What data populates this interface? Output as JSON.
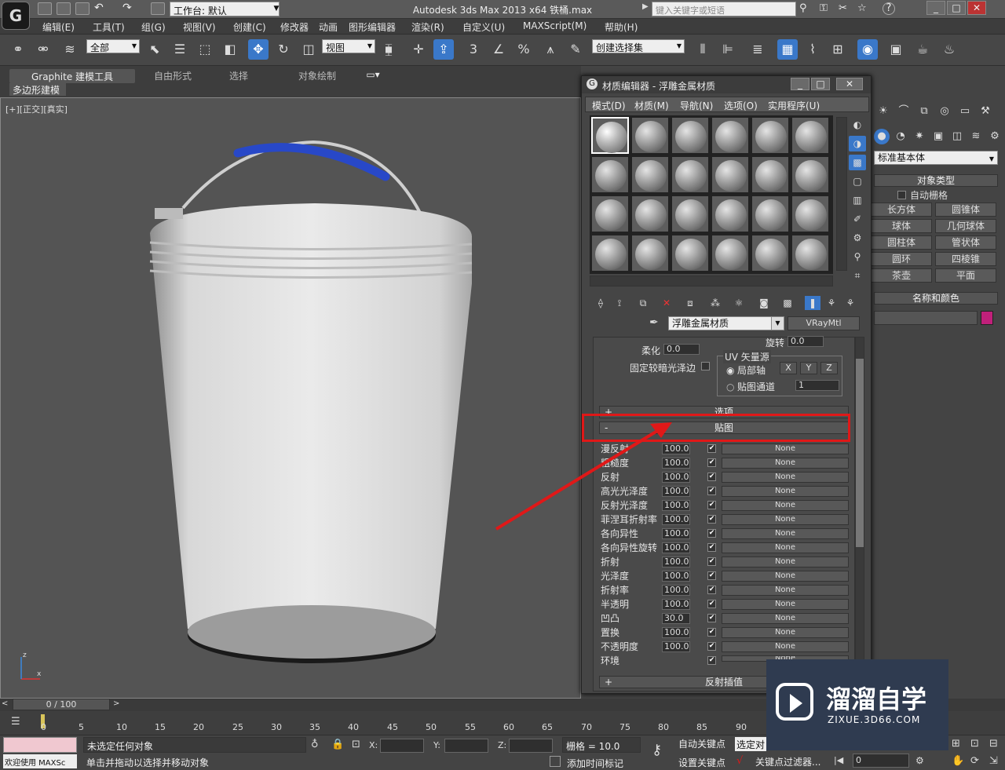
{
  "titlebar": {
    "workspace": "工作台: 默认",
    "title": "Autodesk 3ds Max  2013 x64     铁桶.max",
    "search_placeholder": "键入关键字或短语"
  },
  "menubar": [
    "编辑(E)",
    "工具(T)",
    "组(G)",
    "视图(V)",
    "创建(C)",
    "修改器",
    "动画",
    "图形编辑器",
    "渲染(R)",
    "自定义(U)",
    "MAXScript(M)",
    "帮助(H)"
  ],
  "toolbar": {
    "filter": "全部",
    "coord": "视图",
    "sel_set": "创建选择集",
    "snap_3": "3"
  },
  "ribbon": {
    "tabs": [
      "Graphite 建模工具",
      "自由形式",
      "选择",
      "对象绘制"
    ],
    "sub_tab": "多边形建模"
  },
  "viewport": {
    "label": "[+][正交][真实]"
  },
  "material_editor": {
    "title": "材质编辑器 - 浮雕金属材质",
    "menu": [
      "模式(D)",
      "材质(M)",
      "导航(N)",
      "选项(O)",
      "实用程序(U)"
    ],
    "material_name": "浮雕金属材质",
    "material_type": "VRayMtl",
    "soften_label": "柔化",
    "soften_val": "0.0",
    "fix_gloss_label": "固定较暗光泽边",
    "rotate_label": "旋转",
    "rotate_val": "0.0",
    "uv_group": "UV 矢量源",
    "local_axis": "局部轴",
    "map_channel": "贴图通道",
    "map_channel_val": "1",
    "axes": [
      "X",
      "Y",
      "Z"
    ],
    "rollout_options": "选项",
    "rollout_maps": "贴图",
    "rollout_reflect_interp": "反射插值",
    "maps": [
      {
        "label": "漫反射",
        "value": "100.0",
        "map": "None"
      },
      {
        "label": "粗糙度",
        "value": "100.0",
        "map": "None"
      },
      {
        "label": "反射",
        "value": "100.0",
        "map": "None"
      },
      {
        "label": "高光光泽度",
        "value": "100.0",
        "map": "None"
      },
      {
        "label": "反射光泽度",
        "value": "100.0",
        "map": "None"
      },
      {
        "label": "菲涅耳折射率",
        "value": "100.0",
        "map": "None"
      },
      {
        "label": "各向异性",
        "value": "100.0",
        "map": "None"
      },
      {
        "label": "各向异性旋转",
        "value": "100.0",
        "map": "None"
      },
      {
        "label": "折射",
        "value": "100.0",
        "map": "None"
      },
      {
        "label": "光泽度",
        "value": "100.0",
        "map": "None"
      },
      {
        "label": "折射率",
        "value": "100.0",
        "map": "None"
      },
      {
        "label": "半透明",
        "value": "100.0",
        "map": "None"
      },
      {
        "label": "凹凸",
        "value": "30.0",
        "map": "None"
      },
      {
        "label": "置换",
        "value": "100.0",
        "map": "None"
      },
      {
        "label": "不透明度",
        "value": "100.0",
        "map": "None"
      },
      {
        "label": "环境",
        "value": "",
        "map": "None"
      }
    ]
  },
  "command_panel": {
    "dropdown": "标准基本体",
    "object_type": "对象类型",
    "auto_grid": "自动栅格",
    "buttons": [
      "长方体",
      "圆锥体",
      "球体",
      "几何球体",
      "圆柱体",
      "管状体",
      "圆环",
      "四棱锥",
      "茶壶",
      "平面"
    ],
    "name_color": "名称和颜色",
    "swatch_color": "#c0207a"
  },
  "timeline": {
    "frame": "0 / 100",
    "ticks": [
      "0",
      "5",
      "10",
      "15",
      "20",
      "25",
      "30",
      "35",
      "40",
      "45",
      "50",
      "55",
      "60",
      "65",
      "70",
      "75",
      "80",
      "85",
      "90"
    ]
  },
  "status": {
    "welcome": "欢迎使用 MAXSc",
    "selection": "未选定任何对象",
    "hint": "单击并拖动以选择并移动对象",
    "x_label": "X:",
    "y_label": "Y:",
    "z_label": "Z:",
    "grid": "栅格 = 10.0",
    "add_tag": "添加时间标记",
    "auto_key": "自动关键点",
    "selected": "选定对",
    "set_key": "设置关键点",
    "key_filter": "关键点过滤器...",
    "frame_val": "0"
  },
  "watermark": {
    "brand": "溜溜自学",
    "url": "ZIXUE.3D66.COM"
  }
}
